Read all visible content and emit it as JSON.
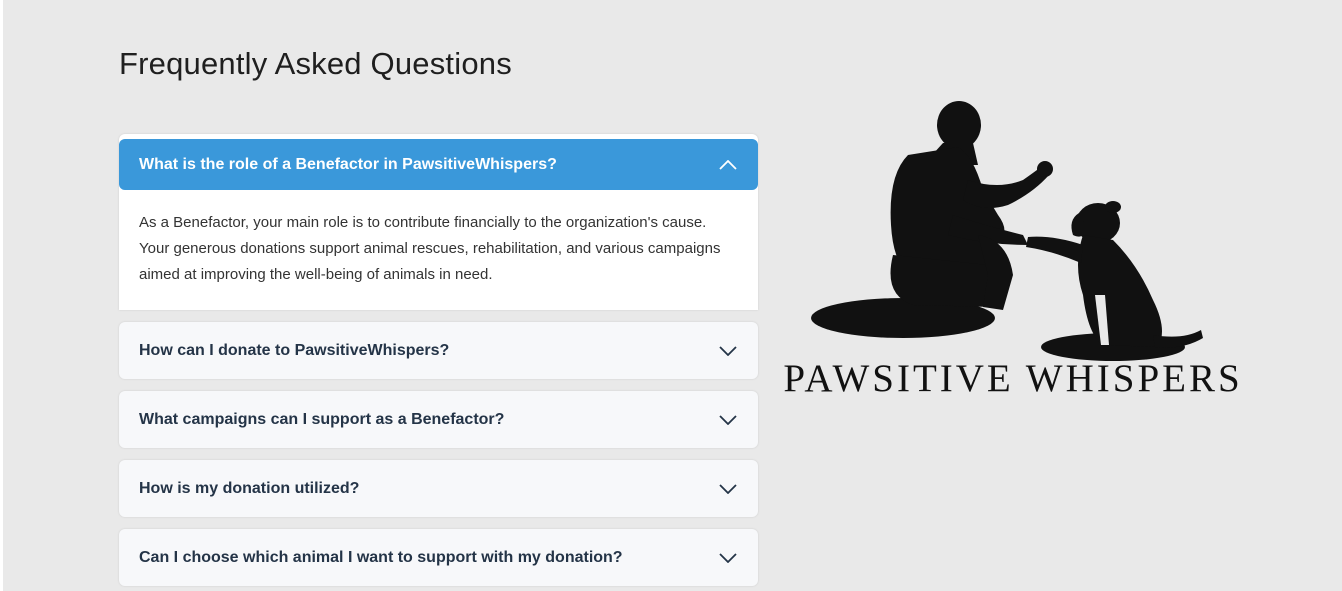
{
  "page": {
    "title": "Frequently Asked Questions"
  },
  "faq": {
    "items": [
      {
        "question": "What is the role of a Benefactor in PawsitiveWhispers?",
        "answer": "As a Benefactor, your main role is to contribute financially to the organization's cause. Your generous donations support animal rescues, rehabilitation, and various campaigns aimed at improving the well-being of animals in need.",
        "expanded": true,
        "icon": "chevron-up-icon"
      },
      {
        "question": "How can I donate to PawsitiveWhispers?",
        "expanded": false,
        "icon": "chevron-down-icon"
      },
      {
        "question": "What campaigns can I support as a Benefactor?",
        "expanded": false,
        "icon": "chevron-down-icon"
      },
      {
        "question": "How is my donation utilized?",
        "expanded": false,
        "icon": "chevron-down-icon"
      },
      {
        "question": "Can I choose which animal I want to support with my donation?",
        "expanded": false,
        "icon": "chevron-down-icon"
      }
    ]
  },
  "logo": {
    "text": "PAWSITIVE WHISPERS",
    "icon": "man-and-dog-silhouette-icon"
  },
  "colors": {
    "accent": "#3a98da",
    "background": "#e9e9e9",
    "question_text": "#243447"
  }
}
